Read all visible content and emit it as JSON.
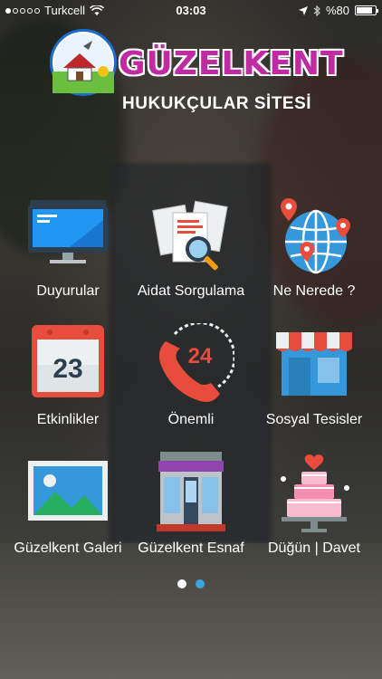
{
  "status": {
    "carrier": "Turkcell",
    "time": "03:03",
    "battery": "%80"
  },
  "header": {
    "brand": "GÜZELKENT",
    "subtitle": "HUKUKÇULAR SİTESİ"
  },
  "tiles": [
    {
      "label": "Duyurular",
      "icon": "monitor-icon"
    },
    {
      "label": "Aidat Sorgulama",
      "icon": "document-search-icon"
    },
    {
      "label": "Ne Nerede ?",
      "icon": "globe-pin-icon"
    },
    {
      "label": "Etkinlikler",
      "icon": "calendar-icon",
      "day": "23"
    },
    {
      "label": "Önemli",
      "icon": "phone-24-icon",
      "hours": "24"
    },
    {
      "label": "Sosyal Tesisler",
      "icon": "shop-icon"
    },
    {
      "label": "Güzelkent Galeri",
      "icon": "image-icon"
    },
    {
      "label": "Güzelkent Esnaf",
      "icon": "store-icon"
    },
    {
      "label": "Düğün | Davet",
      "icon": "cake-icon"
    }
  ],
  "pager": {
    "active": 1,
    "count": 2
  }
}
